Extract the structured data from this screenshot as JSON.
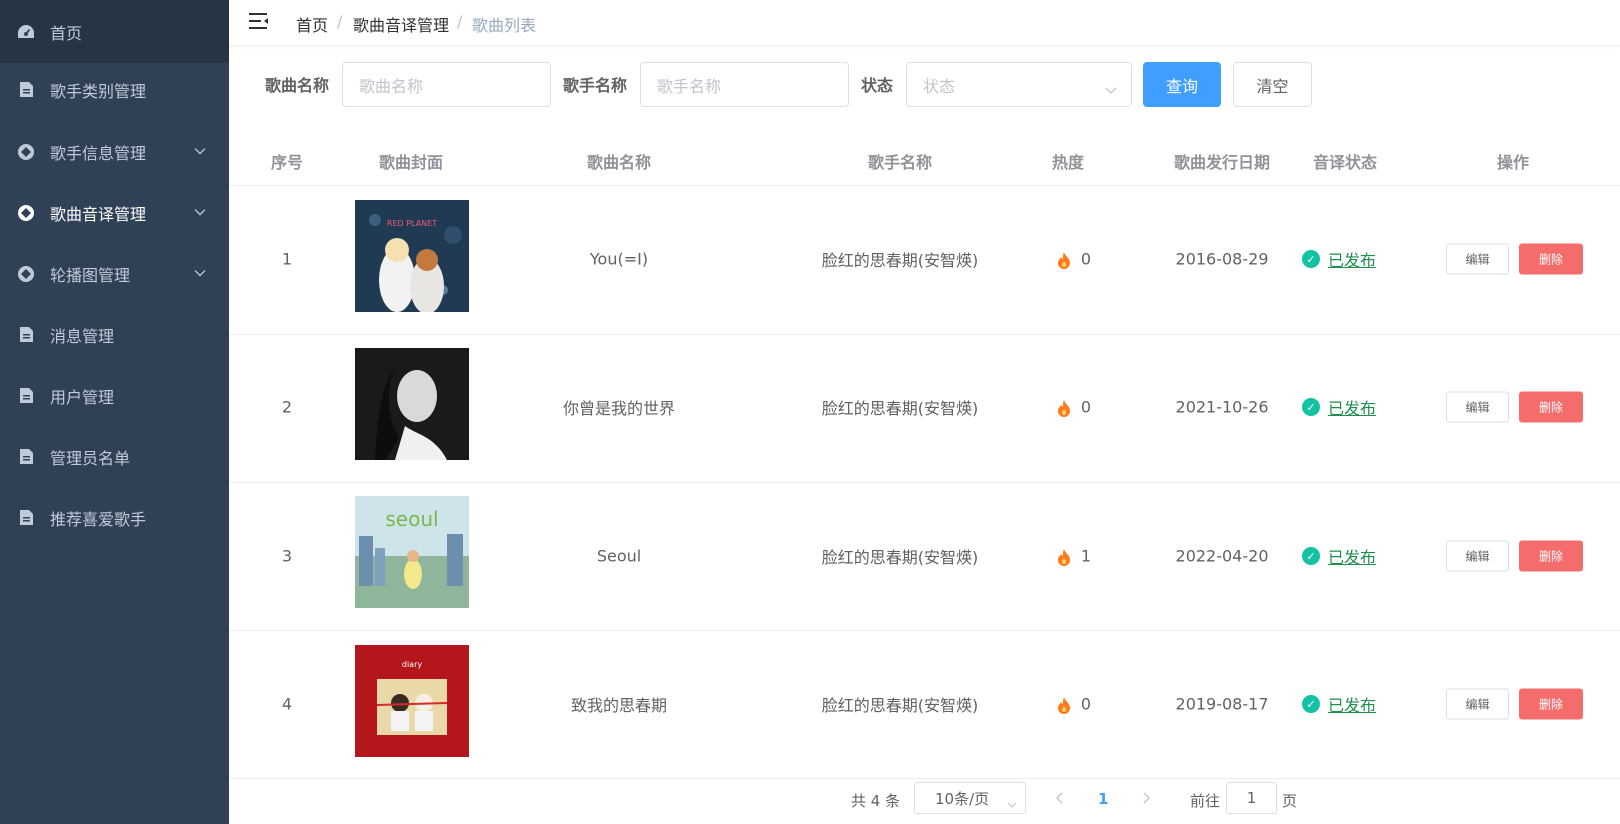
{
  "sidebar": {
    "items": [
      {
        "label": "首页",
        "icon": "dashboard-icon"
      },
      {
        "label": "歌手类别管理",
        "icon": "document-icon"
      },
      {
        "label": "歌手信息管理",
        "icon": "component-icon",
        "expandable": true
      },
      {
        "label": "歌曲音译管理",
        "icon": "component-icon",
        "expandable": true,
        "active": true
      },
      {
        "label": "轮播图管理",
        "icon": "component-icon",
        "expandable": true
      },
      {
        "label": "消息管理",
        "icon": "document-icon"
      },
      {
        "label": "用户管理",
        "icon": "document-icon"
      },
      {
        "label": "管理员名单",
        "icon": "document-icon"
      },
      {
        "label": "推荐喜爱歌手",
        "icon": "document-icon"
      }
    ]
  },
  "breadcrumb": {
    "items": [
      "首页",
      "歌曲音译管理",
      "歌曲列表"
    ],
    "separator": "/"
  },
  "search": {
    "song_label": "歌曲名称",
    "song_placeholder": "歌曲名称",
    "singer_label": "歌手名称",
    "singer_placeholder": "歌手名称",
    "status_label": "状态",
    "status_placeholder": "状态",
    "query_button": "查询",
    "clear_button": "清空"
  },
  "table": {
    "columns": [
      "序号",
      "歌曲封面",
      "歌曲名称",
      "歌手名称",
      "热度",
      "歌曲发行日期",
      "音译状态",
      "操作"
    ],
    "rows": [
      {
        "index": "1",
        "song": "You(=I)",
        "singer": "脸红的思春期(安智煐)",
        "heat": "0",
        "date": "2016-08-29",
        "status": "已发布",
        "edit": "编辑",
        "delete": "删除"
      },
      {
        "index": "2",
        "song": "你曾是我的世界",
        "singer": "脸红的思春期(安智煐)",
        "heat": "0",
        "date": "2021-10-26",
        "status": "已发布",
        "edit": "编辑",
        "delete": "删除"
      },
      {
        "index": "3",
        "song": "Seoul",
        "singer": "脸红的思春期(安智煐)",
        "heat": "1",
        "date": "2022-04-20",
        "status": "已发布",
        "edit": "编辑",
        "delete": "删除"
      },
      {
        "index": "4",
        "song": "致我的思春期",
        "singer": "脸红的思春期(安智煐)",
        "heat": "0",
        "date": "2019-08-17",
        "status": "已发布",
        "edit": "编辑",
        "delete": "删除"
      }
    ],
    "covers": [
      {
        "text": "RED PLANET"
      },
      {
        "text": ""
      },
      {
        "text": "seoul"
      },
      {
        "text": "diary"
      }
    ]
  },
  "pagination": {
    "total": "共 4 条",
    "page_size": "10条/页",
    "current_page": "1",
    "goto_label": "前往",
    "goto_value": "1",
    "page_suffix": "页"
  },
  "colors": {
    "sidebar_bg": "#304156",
    "primary": "#409eff",
    "danger": "#f56c6c",
    "success": "#13c2a2",
    "fire": "#ff7a1a"
  }
}
